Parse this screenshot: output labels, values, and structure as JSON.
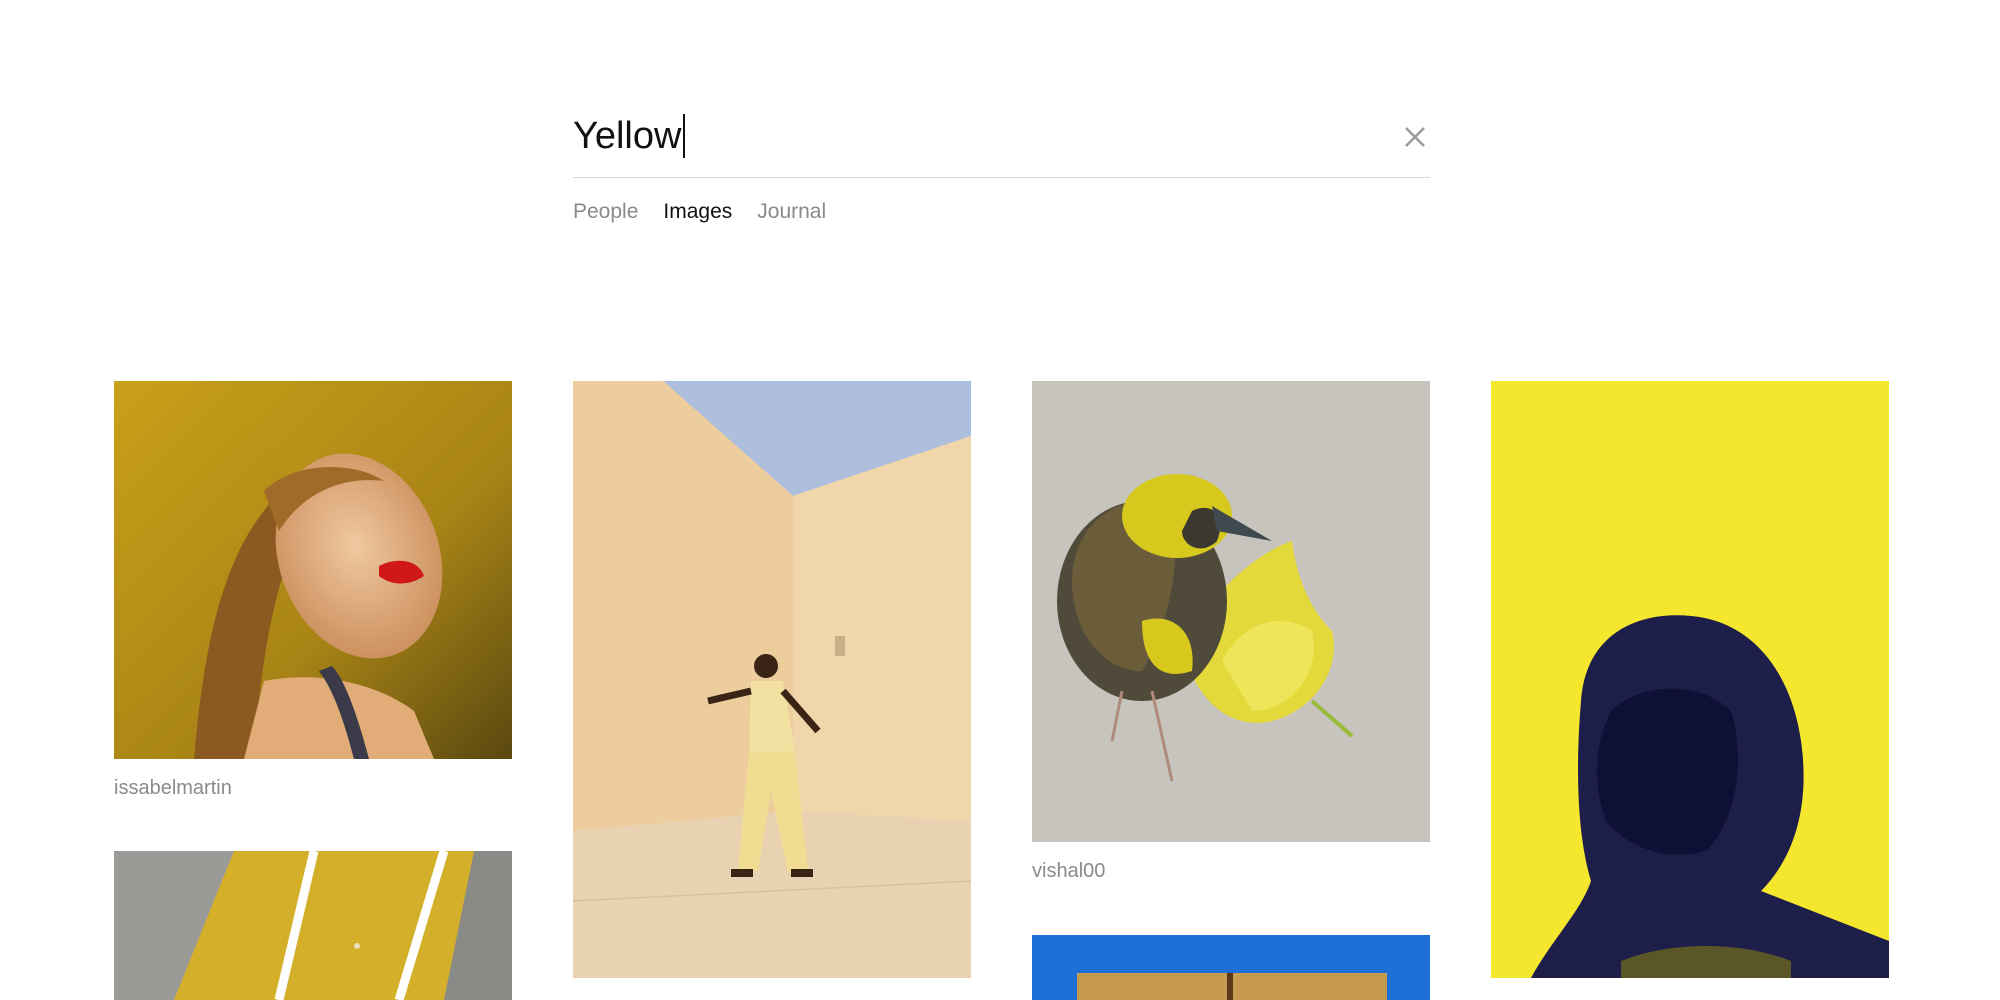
{
  "search": {
    "query": "Yellow",
    "clear_icon": "close-icon"
  },
  "tabs": [
    {
      "label": "People",
      "active": false
    },
    {
      "label": "Images",
      "active": true
    },
    {
      "label": "Journal",
      "active": false
    }
  ],
  "results": [
    {
      "author": "issabelmartin",
      "subject": "portrait-woman-red-lips"
    },
    {
      "author": "",
      "subject": "man-dancing-courtyard"
    },
    {
      "author": "vishal00",
      "subject": "yellow-weaver-bird-flower"
    },
    {
      "author": "",
      "subject": "hooded-figure-yellow-duotone"
    },
    {
      "author": "",
      "subject": "yellow-ceiling-lights"
    },
    {
      "author": "",
      "subject": "blue-frame-wood"
    }
  ],
  "colors": {
    "accent_yellow": "#f5e62e",
    "caption_gray": "#8a8a8a",
    "divider": "#d6d6d6"
  }
}
